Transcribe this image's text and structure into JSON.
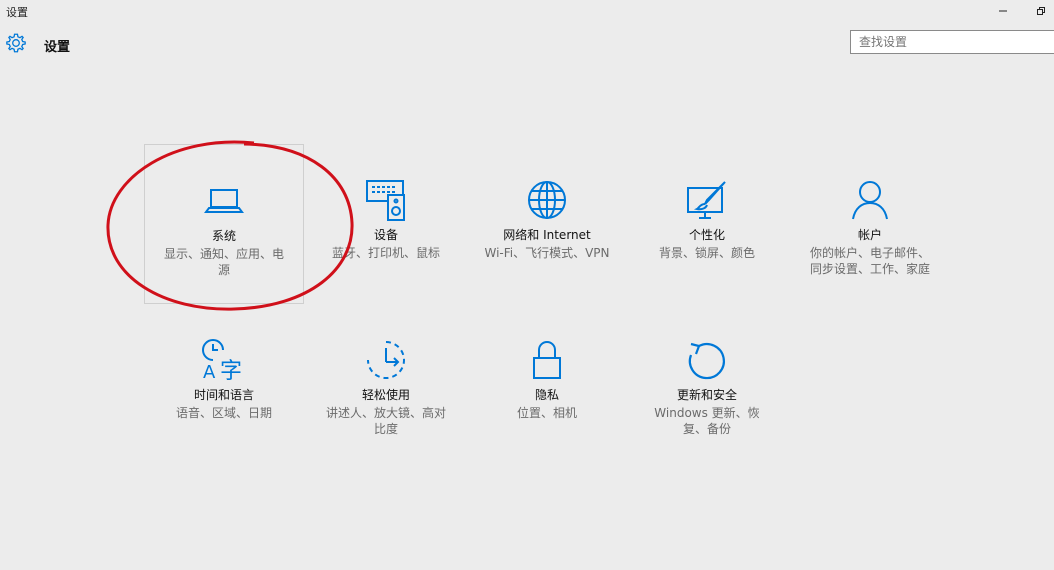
{
  "window": {
    "title": "设置"
  },
  "header": {
    "title": "设置",
    "search_placeholder": "查找设置"
  },
  "tiles": [
    {
      "label": "系统",
      "desc": "显示、通知、应用、电源",
      "icon": "laptop-icon"
    },
    {
      "label": "设备",
      "desc": "蓝牙、打印机、鼠标",
      "icon": "devices-icon"
    },
    {
      "label": "网络和 Internet",
      "desc": "Wi-Fi、飞行模式、VPN",
      "icon": "globe-icon"
    },
    {
      "label": "个性化",
      "desc": "背景、锁屏、颜色",
      "icon": "personalization-icon"
    },
    {
      "label": "帐户",
      "desc": "你的帐户、电子邮件、同步设置、工作、家庭",
      "icon": "person-icon"
    },
    {
      "label": "时间和语言",
      "desc": "语音、区域、日期",
      "icon": "time-language-icon"
    },
    {
      "label": "轻松使用",
      "desc": "讲述人、放大镜、高对比度",
      "icon": "ease-of-access-icon"
    },
    {
      "label": "隐私",
      "desc": "位置、相机",
      "icon": "lock-icon"
    },
    {
      "label": "更新和安全",
      "desc": "Windows 更新、恢复、备份",
      "icon": "update-icon"
    }
  ],
  "colors": {
    "accent": "#0078d7",
    "annotation": "#d0101a",
    "background": "#ececec"
  }
}
